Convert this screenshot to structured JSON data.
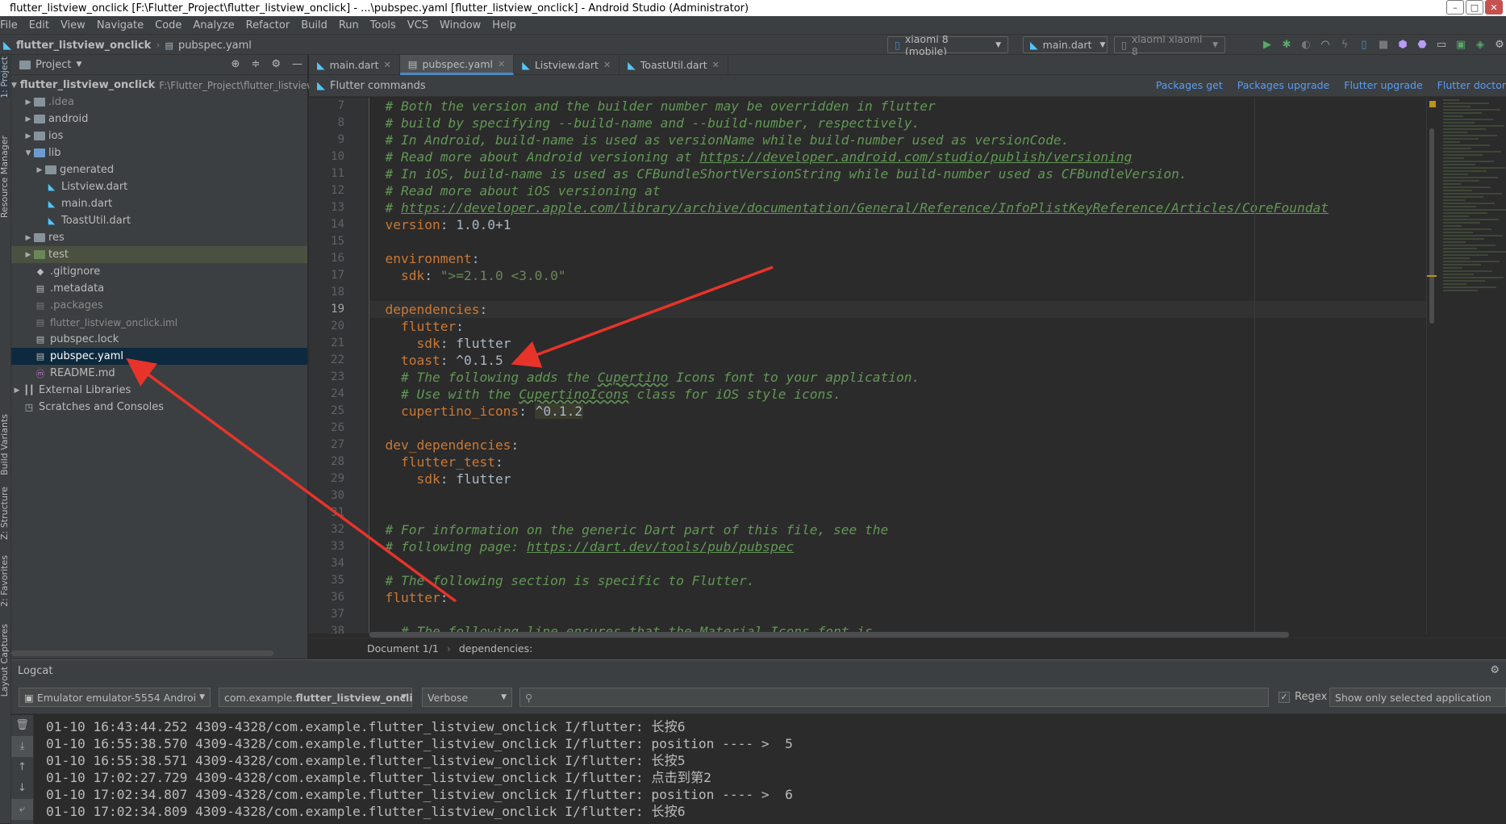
{
  "window": {
    "title": "flutter_listview_onclick [F:\\Flutter_Project\\flutter_listview_onclick] - ...\\pubspec.yaml [flutter_listview_onclick] - Android Studio (Administrator)",
    "controls": [
      "–",
      "□",
      "✕"
    ]
  },
  "menu": [
    "File",
    "Edit",
    "View",
    "Navigate",
    "Code",
    "Analyze",
    "Refactor",
    "Build",
    "Run",
    "Tools",
    "VCS",
    "Window",
    "Help"
  ],
  "breadcrumb": {
    "project": "flutter_listview_onclick",
    "file": "pubspec.yaml"
  },
  "toolbar": {
    "device_combo": "xiaomi 8 (mobile)",
    "run_config_combo": "main.dart",
    "target_combo": "xiaomi xiaomi 8"
  },
  "project_panel": {
    "title": "Project",
    "tree": [
      {
        "label": "flutter_listview_onclick",
        "suffix": "F:\\Flutter_Project\\flutter_listview",
        "bold": true
      },
      {
        "label": ".idea"
      },
      {
        "label": "android"
      },
      {
        "label": "ios"
      },
      {
        "label": "lib"
      },
      {
        "label": "generated"
      },
      {
        "label": "Listview.dart"
      },
      {
        "label": "main.dart"
      },
      {
        "label": "ToastUtil.dart"
      },
      {
        "label": "res"
      },
      {
        "label": "test"
      },
      {
        "label": ".gitignore"
      },
      {
        "label": ".metadata"
      },
      {
        "label": ".packages"
      },
      {
        "label": "flutter_listview_onclick.iml"
      },
      {
        "label": "pubspec.lock"
      },
      {
        "label": "pubspec.yaml"
      },
      {
        "label": "README.md"
      },
      {
        "label": "External Libraries"
      },
      {
        "label": "Scratches and Consoles"
      }
    ]
  },
  "side_tabs": {
    "project": "1: Project",
    "resource": "Resource Manager",
    "variants": "Build Variants",
    "structure": "Z: Structure",
    "favorites": "2: Favorites",
    "captures": "Layout Captures"
  },
  "editor_tabs": [
    "main.dart",
    "pubspec.yaml",
    "Listview.dart",
    "ToastUtil.dart"
  ],
  "flutter_bar": {
    "title": "Flutter commands",
    "links": [
      "Packages get",
      "Packages upgrade",
      "Flutter upgrade",
      "Flutter doctor"
    ]
  },
  "editor": {
    "line_numbers": [
      "7",
      "8",
      "9",
      "10",
      "11",
      "12",
      "13",
      "14",
      "15",
      "16",
      "17",
      "18",
      "19",
      "20",
      "21",
      "22",
      "23",
      "24",
      "25",
      "26",
      "27",
      "28",
      "29",
      "30",
      "31",
      "32",
      "33",
      "34",
      "35",
      "36",
      "37",
      "38"
    ],
    "lines": {
      "l7": "# Both the version and the builder number may be overridden in flutter",
      "l8": "# build by specifying --build-name and --build-number, respectively.",
      "l9": "# In Android, build-name is used as versionName while build-number used as versionCode.",
      "l10a": "# Read more about Android versioning at ",
      "l10b": "https://developer.android.com/studio/publish/versioning",
      "l11": "# In iOS, build-name is used as CFBundleShortVersionString while build-number used as CFBundleVersion.",
      "l12": "# Read more about iOS versioning at",
      "l13a": "# ",
      "l13b": "https://developer.apple.com/library/archive/documentation/General/Reference/InfoPlistKeyReference/Articles/CoreFoundat",
      "l14k": "version",
      "l14v": ": 1.0.0+1",
      "l16": "environment",
      "l17k": "  sdk",
      "l17v": "\">=2.1.0 <3.0.0\"",
      "l19": "dependencies",
      "l20": "  flutter",
      "l21k": "    sdk",
      "l21v": ": flutter",
      "l22k": "  toast",
      "l22v": ": ^0.1.5",
      "l23a": "  # The following adds the ",
      "l23b": "Cupertino",
      "l23c": " Icons font to your application.",
      "l24a": "  # Use with the ",
      "l24b": "CupertinoIcons",
      "l24c": " class for iOS style icons.",
      "l25k": "  cupertino_icons",
      "l25v": "^0.1.2",
      "l27": "dev_dependencies",
      "l28": "  flutter_test",
      "l29k": "    sdk",
      "l29v": ": flutter",
      "l32": "# For information on the generic Dart part of this file, see the",
      "l33a": "# following page: ",
      "l33b": "https://dart.dev/tools/pub/pubspec",
      "l35": "# The following section is specific to Flutter.",
      "l36": "flutter",
      "l38": "  # The following line ensures that the Material Icons font is"
    },
    "status": {
      "document": "Document 1/1",
      "path": "dependencies:"
    }
  },
  "logcat": {
    "title": "Logcat",
    "device": "Emulator emulator-5554 Androi",
    "process_prefix": "com.example.",
    "process_bold": "flutter_listview_oncli",
    "level": "Verbose",
    "search_placeholder": "",
    "regex_label": "Regex",
    "filter": "Show only selected application",
    "lines": [
      "01-10 16:43:44.252 4309-4328/com.example.flutter_listview_onclick I/flutter: 长按6",
      "01-10 16:55:38.570 4309-4328/com.example.flutter_listview_onclick I/flutter: position ---- >  5",
      "01-10 16:55:38.571 4309-4328/com.example.flutter_listview_onclick I/flutter: 长按5",
      "01-10 17:02:27.729 4309-4328/com.example.flutter_listview_onclick I/flutter: 点击到第2",
      "01-10 17:02:34.807 4309-4328/com.example.flutter_listview_onclick I/flutter: position ---- >  6",
      "01-10 17:02:34.809 4309-4328/com.example.flutter_listview_onclick I/flutter: 长按6"
    ]
  },
  "colors": {
    "arrow": "#e8332a",
    "accent": "#4a88c7",
    "comment": "#629755",
    "keyword": "#cc7832"
  }
}
